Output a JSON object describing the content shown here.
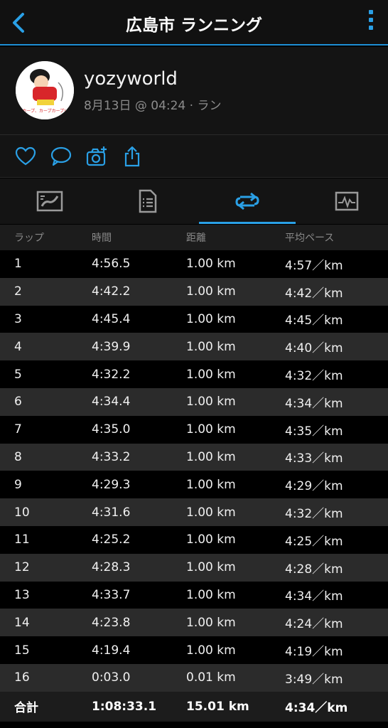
{
  "header": {
    "title": "広島市 ランニング",
    "back_icon": "chevron-left-icon",
    "menu_icon": "more-vertical-icon"
  },
  "profile": {
    "username": "yozyworld",
    "meta": "8月13日 @ 04:24 · ラン",
    "avatar_caption": "カープ、カープカープ!"
  },
  "actions": [
    "heart-icon",
    "comment-icon",
    "add-photo-icon",
    "share-icon"
  ],
  "tabs": [
    {
      "icon": "map-icon",
      "active": false
    },
    {
      "icon": "stats-document-icon",
      "active": false
    },
    {
      "icon": "laps-loop-icon",
      "active": true
    },
    {
      "icon": "chart-icon",
      "active": false
    }
  ],
  "colors": {
    "accent": "#2aa0e6",
    "background": "#000000"
  },
  "laps_table": {
    "headers": [
      "ラップ",
      "時間",
      "距離",
      "平均ペース"
    ],
    "rows": [
      [
        "1",
        "4:56.5",
        "1.00 km",
        "4:57／km"
      ],
      [
        "2",
        "4:42.2",
        "1.00 km",
        "4:42／km"
      ],
      [
        "3",
        "4:45.4",
        "1.00 km",
        "4:45／km"
      ],
      [
        "4",
        "4:39.9",
        "1.00 km",
        "4:40／km"
      ],
      [
        "5",
        "4:32.2",
        "1.00 km",
        "4:32／km"
      ],
      [
        "6",
        "4:34.4",
        "1.00 km",
        "4:34／km"
      ],
      [
        "7",
        "4:35.0",
        "1.00 km",
        "4:35／km"
      ],
      [
        "8",
        "4:33.2",
        "1.00 km",
        "4:33／km"
      ],
      [
        "9",
        "4:29.3",
        "1.00 km",
        "4:29／km"
      ],
      [
        "10",
        "4:31.6",
        "1.00 km",
        "4:32／km"
      ],
      [
        "11",
        "4:25.2",
        "1.00 km",
        "4:25／km"
      ],
      [
        "12",
        "4:28.3",
        "1.00 km",
        "4:28／km"
      ],
      [
        "13",
        "4:33.7",
        "1.00 km",
        "4:34／km"
      ],
      [
        "14",
        "4:23.8",
        "1.00 km",
        "4:24／km"
      ],
      [
        "15",
        "4:19.4",
        "1.00 km",
        "4:19／km"
      ],
      [
        "16",
        "0:03.0",
        "0.01 km",
        "3:49／km"
      ]
    ],
    "total": [
      "合計",
      "1:08:33.1",
      "15.01 km",
      "4:34／km"
    ]
  }
}
